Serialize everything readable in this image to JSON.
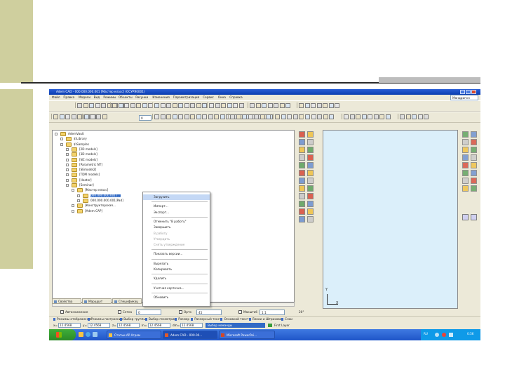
{
  "app": {
    "title": "Adem CAD - 000.000.000.001 [Мастер класс] (ОСУРЯ0001)"
  },
  "menu": [
    "Файл",
    "Правка",
    "Модели",
    "Вид",
    "Режимы",
    "Объекты",
    "Рисунки",
    "Изменения",
    "Параметризация",
    "Сервис",
    "Окна",
    "Справка"
  ],
  "menu_selector": "Мандригон",
  "toolbar": {
    "fields": {
      "layer_value": "0",
      "linetype_value": "—",
      "width_value": "0"
    }
  },
  "tree": {
    "items": [
      {
        "label": "AdemVault"
      },
      {
        "label": "$\\Library"
      },
      {
        "label": "$\\Samples"
      },
      {
        "label": "[2D models]"
      },
      {
        "label": "[3D models]"
      },
      {
        "label": "[NC models]"
      },
      {
        "label": "[Parametric NT]"
      },
      {
        "label": "[SEmodel2]"
      },
      {
        "label": "[TDM models]"
      },
      {
        "label": "[Heater]"
      },
      {
        "label": "[Seminar]"
      },
      {
        "label": "[Мастер класс]"
      },
      {
        "label": "000.000.000.001 [..."
      },
      {
        "label": "000.000.000.001[Pad]"
      },
      {
        "label": "[Конструкторская..."
      },
      {
        "label": "[Adem CAP]"
      }
    ]
  },
  "context_menu": {
    "items": [
      {
        "label": "Загрузить",
        "disabled": false,
        "highlighted": true
      },
      {
        "sep": true
      },
      {
        "label": "Импорт...",
        "disabled": false
      },
      {
        "label": "Экспорт...",
        "disabled": false
      },
      {
        "sep": true
      },
      {
        "label": "Отменить \"В работу\"",
        "disabled": false
      },
      {
        "label": "Завершить",
        "disabled": false
      },
      {
        "label": "В работу",
        "disabled": true
      },
      {
        "label": "Утвердить",
        "disabled": true
      },
      {
        "label": "Снять утверждение",
        "disabled": true
      },
      {
        "sep": true
      },
      {
        "label": "Показать версии...",
        "disabled": false
      },
      {
        "sep": true
      },
      {
        "label": "Вырезать",
        "disabled": false
      },
      {
        "label": "Копировать",
        "disabled": false
      },
      {
        "sep": true
      },
      {
        "label": "Удалить",
        "disabled": false
      },
      {
        "sep": true
      },
      {
        "label": "Учетная карточка...",
        "disabled": false
      },
      {
        "sep": true
      },
      {
        "label": "Обновить",
        "disabled": false
      }
    ]
  },
  "panel_tabs": [
    "Свойства",
    "Маршрут",
    "Спецификац"
  ],
  "status_panel": {
    "auto_label": "Автоснижение",
    "grid_label": "Сетка",
    "grid_value": "0",
    "ortho_label": "Орто",
    "ortho_value": "45",
    "scale_label": "Масштаб",
    "scale_value": "1:1",
    "angle_value": "20°"
  },
  "mode_tabs": [
    "Режимы отображения",
    "Режимы построения",
    "Выбор группы",
    "Выбор геометрии",
    "Размер",
    "Размерный текст",
    "Основной текст",
    "Линии и Штриховки",
    "Слои"
  ],
  "coords": {
    "x": "12.4568",
    "y": "12.4568",
    "z": "12.4568",
    "ln": "12.4568",
    "dm": "12.4568",
    "command": "Выбор команды",
    "layer": "First Layer"
  },
  "taskbar": {
    "tasks": [
      "Статьи АР Агрем",
      "Adem CAD - 000.00...",
      "Microsoft PowerPoi..."
    ],
    "lang": "RU",
    "clock": "0:56"
  },
  "canvas": {
    "axis_y": "Y",
    "axis_x": "X"
  },
  "colors": {
    "olive": "#cfcf9e",
    "titlebar": "#1847c2",
    "canvas": "#dbeffa"
  }
}
